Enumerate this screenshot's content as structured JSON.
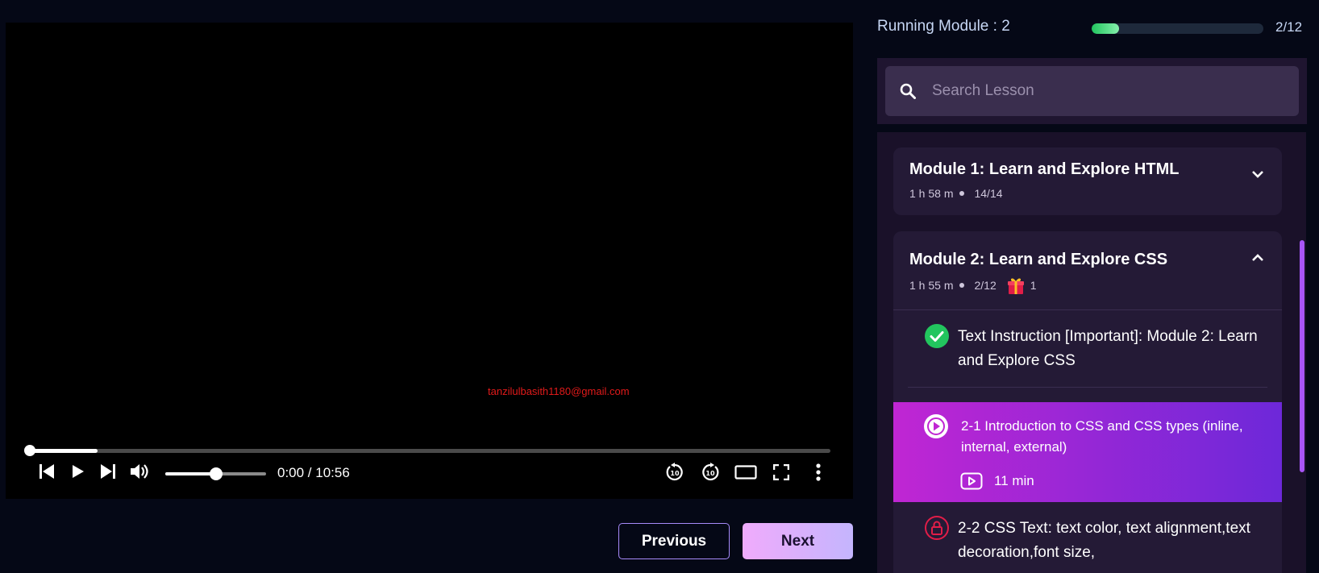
{
  "video": {
    "watermark": "tanzilulbasith1180@gmail.com",
    "time": "0:00 / 10:56",
    "progress_fraction": 0.085,
    "volume_fraction": 0.5
  },
  "nav": {
    "previous_label": "Previous",
    "next_label": "Next"
  },
  "sidebar": {
    "running_module": "Running Module : 2",
    "progress_count": "2/12",
    "progress_fraction": 0.16,
    "search_placeholder": "Search Lesson",
    "modules": [
      {
        "title": "Module 1: Learn and Explore HTML",
        "duration": "1 h 58 m",
        "count": "14/14"
      },
      {
        "title": "Module 2: Learn and Explore CSS",
        "duration": "1 h 55 m",
        "count": "2/12",
        "gift_count": "1",
        "lessons": [
          {
            "title": "Text Instruction [Important]: Module 2: Learn and Explore CSS",
            "status": "completed"
          },
          {
            "title": "2-1 Introduction to CSS and CSS types (inline, internal, external)",
            "duration": "11 min",
            "status": "active"
          },
          {
            "title": "2-2 CSS Text: text color, text alignment,text decoration,font size,",
            "status": "locked"
          }
        ]
      }
    ]
  },
  "colors": {
    "accent_active_start": "#c026d3",
    "accent_active_end": "#6d28d9",
    "progress": "#22c55e",
    "check": "#22c55e",
    "lock": "#e11d48"
  }
}
